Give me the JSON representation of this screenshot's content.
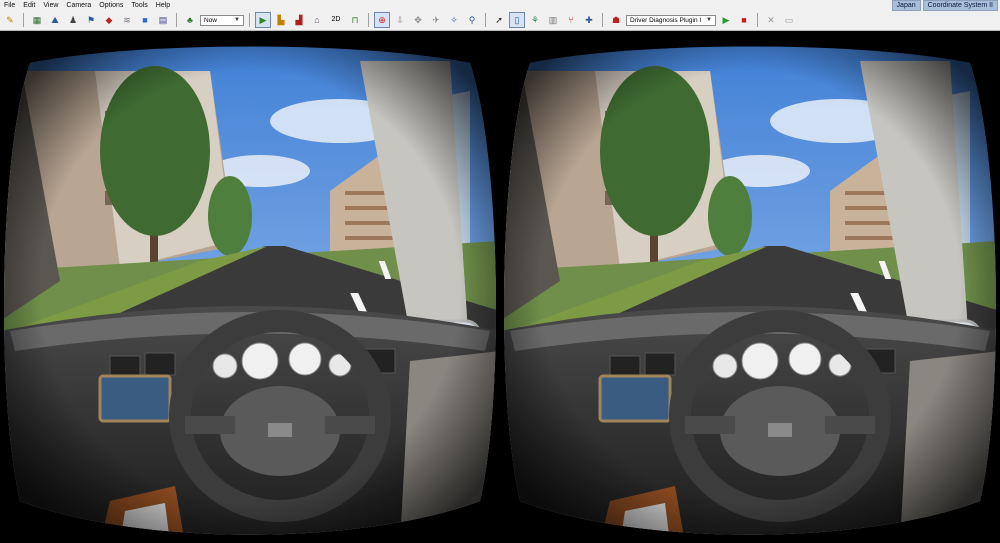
{
  "menu": [
    "File",
    "Edit",
    "View",
    "Camera",
    "Options",
    "Tools",
    "Help"
  ],
  "toolbar": {
    "view_mode": "Now",
    "mode_2d": "2D",
    "plugin": "Driver Diagnosis Plugin I"
  },
  "status": {
    "region": "Japan",
    "coord": "Coordinate System II"
  },
  "icons": [
    "pencil-icon",
    "grid-icon",
    "person-icon",
    "flag-icon",
    "car-icon",
    "terrain-icon",
    "cube-icon",
    "road-icon",
    "layers-icon",
    "play-icon",
    "stop-icon",
    "cross-icon",
    "export-icon"
  ],
  "colors": {
    "sky": "#5a8fd6",
    "accent": "#d04020",
    "play": "#2a9a2a",
    "stop": "#d01818"
  }
}
